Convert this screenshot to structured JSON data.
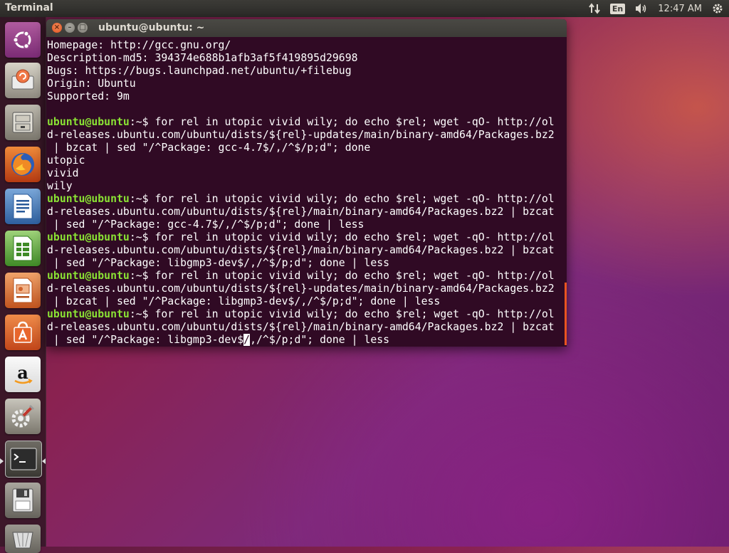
{
  "panel": {
    "app_title": "Terminal",
    "keyboard": "En",
    "time": "12:47 AM",
    "icons": [
      "network-icon",
      "keyboard-layout-icon",
      "volume-icon",
      "session-gear-icon"
    ]
  },
  "launcher": {
    "items": [
      {
        "name": "ubuntu-dash"
      },
      {
        "name": "software-updater"
      },
      {
        "name": "files"
      },
      {
        "name": "firefox"
      },
      {
        "name": "libreoffice-writer"
      },
      {
        "name": "libreoffice-calc"
      },
      {
        "name": "libreoffice-impress"
      },
      {
        "name": "ubuntu-software-center"
      },
      {
        "name": "amazon"
      },
      {
        "name": "system-settings"
      },
      {
        "name": "terminal"
      },
      {
        "name": "drive"
      },
      {
        "name": "trash"
      }
    ]
  },
  "window": {
    "title": "ubuntu@ubuntu: ~",
    "buttons": {
      "close": "×",
      "minimize": "–",
      "maximize": "□"
    }
  },
  "terminal": {
    "prompt_user": "ubuntu@ubuntu",
    "prompt_path": ":~$ ",
    "lines": [
      {
        "type": "out",
        "text": "Homepage: http://gcc.gnu.org/"
      },
      {
        "type": "out",
        "text": "Description-md5: 394374e688b1afb3af5f419895d29698"
      },
      {
        "type": "out",
        "text": "Bugs: https://bugs.launchpad.net/ubuntu/+filebug"
      },
      {
        "type": "out",
        "text": "Origin: Ubuntu"
      },
      {
        "type": "out",
        "text": "Supported: 9m"
      },
      {
        "type": "out",
        "text": ""
      },
      {
        "type": "prompt",
        "text": "for rel in utopic vivid wily; do echo $rel; wget -qO- http://ol"
      },
      {
        "type": "out",
        "text": "d-releases.ubuntu.com/ubuntu/dists/${rel}-updates/main/binary-amd64/Packages.bz2"
      },
      {
        "type": "out",
        "text": " | bzcat | sed \"/^Package: gcc-4.7$/,/^$/p;d\"; done"
      },
      {
        "type": "out",
        "text": "utopic"
      },
      {
        "type": "out",
        "text": "vivid"
      },
      {
        "type": "out",
        "text": "wily"
      },
      {
        "type": "prompt",
        "text": "for rel in utopic vivid wily; do echo $rel; wget -qO- http://ol"
      },
      {
        "type": "out",
        "text": "d-releases.ubuntu.com/ubuntu/dists/${rel}/main/binary-amd64/Packages.bz2 | bzcat"
      },
      {
        "type": "out",
        "text": " | sed \"/^Package: gcc-4.7$/,/^$/p;d\"; done | less"
      },
      {
        "type": "prompt",
        "text": "for rel in utopic vivid wily; do echo $rel; wget -qO- http://ol"
      },
      {
        "type": "out",
        "text": "d-releases.ubuntu.com/ubuntu/dists/${rel}/main/binary-amd64/Packages.bz2 | bzcat"
      },
      {
        "type": "out",
        "text": " | sed \"/^Package: libgmp3-dev$/,/^$/p;d\"; done | less"
      },
      {
        "type": "prompt",
        "text": "for rel in utopic vivid wily; do echo $rel; wget -qO- http://ol"
      },
      {
        "type": "out",
        "text": "d-releases.ubuntu.com/ubuntu/dists/${rel}-updates/main/binary-amd64/Packages.bz2"
      },
      {
        "type": "out",
        "text": " | bzcat | sed \"/^Package: libgmp3-dev$/,/^$/p;d\"; done | less"
      },
      {
        "type": "prompt",
        "text": "for rel in utopic vivid wily; do echo $rel; wget -qO- http://ol"
      },
      {
        "type": "out",
        "text": "d-releases.ubuntu.com/ubuntu/dists/${rel}/main/binary-amd64/Packages.bz2 | bzcat"
      },
      {
        "type": "cursor",
        "before": " | sed \"/^Package: libgmp3-dev$",
        "cursor": "/",
        "after": ",/^$/p;d\"; done | less"
      }
    ]
  },
  "colors": {
    "terminal_bg": "#300a24",
    "prompt_user": "#8ae234",
    "prompt_path": "#729fcf",
    "accent": "#e95420"
  }
}
